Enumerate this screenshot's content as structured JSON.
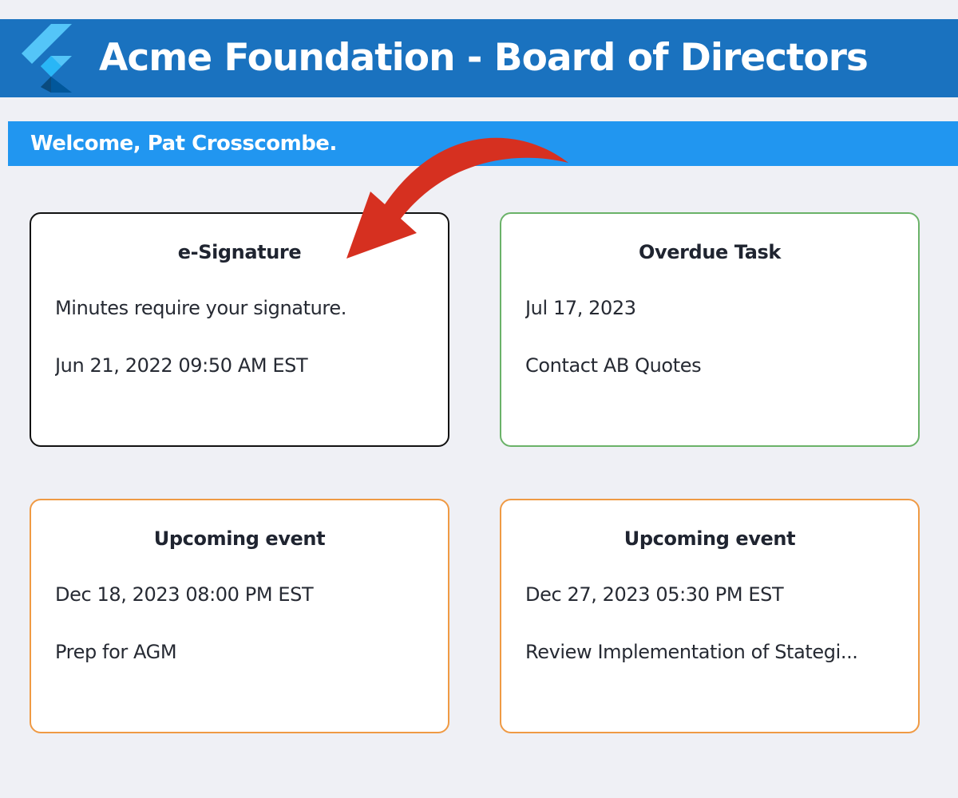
{
  "header": {
    "title": "Acme Foundation - Board of Directors",
    "logo_icon": "flutter-logo-icon",
    "background_color": "#1a72bf"
  },
  "welcome": {
    "text": "Welcome, Pat Crosscombe.",
    "background_color": "#2196f0"
  },
  "cards": [
    {
      "title": "e-Signature",
      "line1": "Minutes require your signature.",
      "line2": "Jun 21, 2022 09:50 AM EST",
      "border_color": "#111111"
    },
    {
      "title": "Overdue Task",
      "line1": "Jul 17, 2023",
      "line2": "Contact AB Quotes",
      "border_color": "#6ab268"
    },
    {
      "title": "Upcoming event",
      "line1": "Dec 18, 2023 08:00 PM EST",
      "line2": "Prep for AGM",
      "border_color": "#ef9a44"
    },
    {
      "title": "Upcoming event",
      "line1": "Dec 27, 2023 05:30 PM EST",
      "line2": "Review Implementation of Stategi...",
      "border_color": "#ef9a44"
    }
  ],
  "annotation": {
    "arrow_icon": "curved-arrow-icon",
    "arrow_color": "#d63020"
  }
}
